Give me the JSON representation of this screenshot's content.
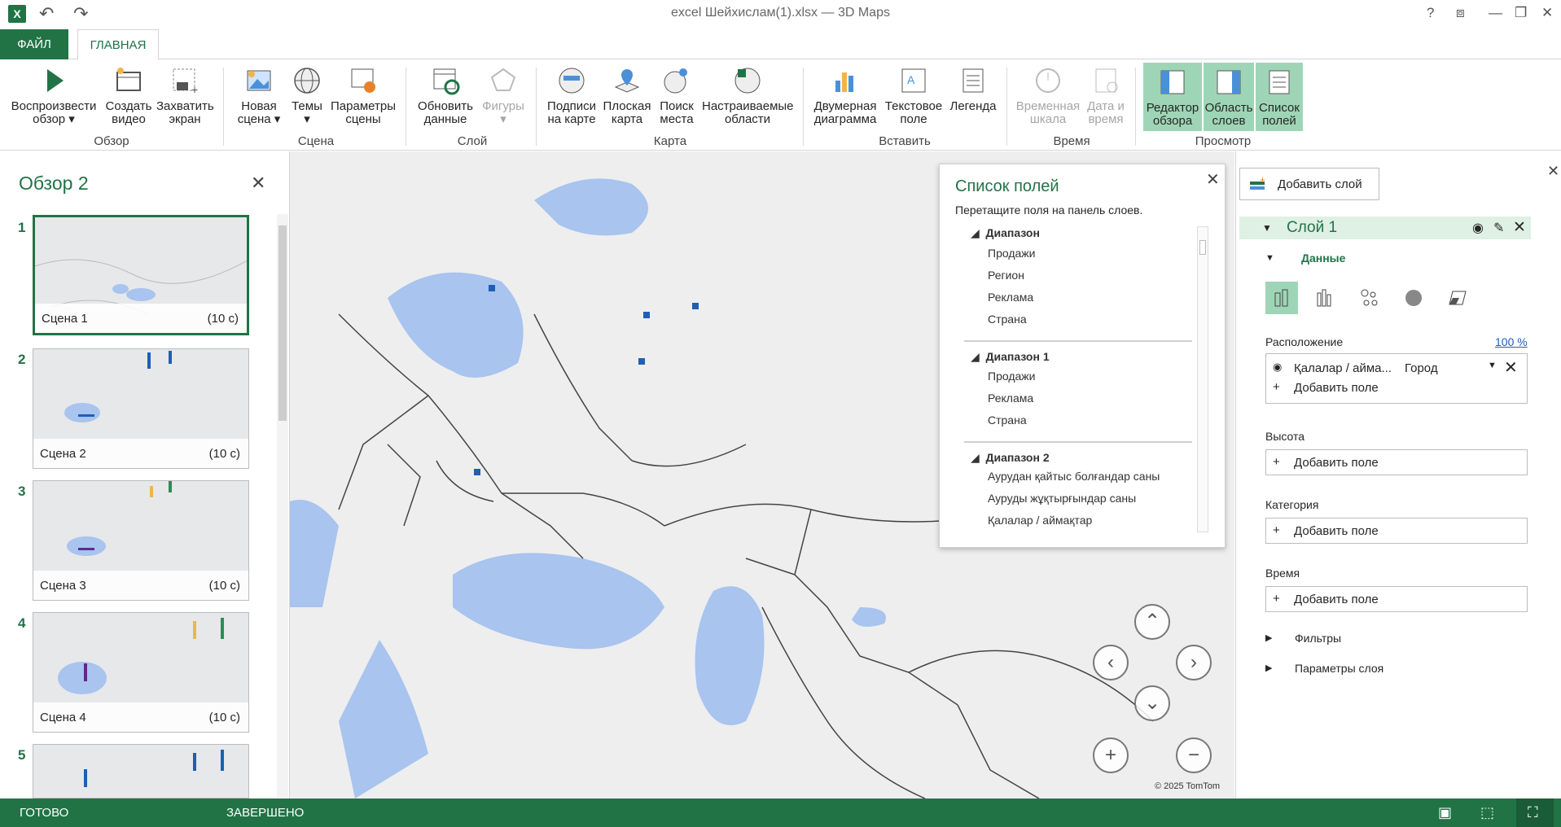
{
  "window": {
    "title": "excel Шейхислам(1).xlsx — 3D Maps"
  },
  "tabs": {
    "file": "ФАЙЛ",
    "home": "ГЛАВНАЯ"
  },
  "ribbon": {
    "groups": {
      "tour": "Обзор",
      "scene": "Сцена",
      "layer": "Слой",
      "map": "Карта",
      "insert": "Вставить",
      "time": "Время",
      "view": "Просмотр"
    },
    "buttons": {
      "play": "Воспроизвести обзор",
      "create_video": "Создать видео",
      "capture": "Захватить экран",
      "new_scene": "Новая сцена",
      "themes": "Темы",
      "scene_options": "Параметры сцены",
      "refresh": "Обновить данные",
      "shapes": "Фигуры",
      "map_labels": "Подписи на карте",
      "flat_map": "Плоская карта",
      "find_place": "Поиск места",
      "custom_regions": "Настраиваемые области",
      "chart2d": "Двумерная диаграмма",
      "textbox": "Текстовое поле",
      "legend": "Легенда",
      "timeline": "Временная шкала",
      "datetime": "Дата и время",
      "tour_editor": "Редактор обзора",
      "layer_pane": "Область слоев",
      "field_list": "Список полей"
    }
  },
  "tour_panel": {
    "title": "Обзор 2",
    "scenes": [
      {
        "num": "1",
        "name": "Сцена 1",
        "duration": "(10 с)"
      },
      {
        "num": "2",
        "name": "Сцена 2",
        "duration": "(10 с)"
      },
      {
        "num": "3",
        "name": "Сцена 3",
        "duration": "(10 с)"
      },
      {
        "num": "4",
        "name": "Сцена 4",
        "duration": "(10 с)"
      },
      {
        "num": "5",
        "name": "",
        "duration": ""
      }
    ]
  },
  "field_list": {
    "title": "Список полей",
    "hint": "Перетащите поля на панель слоев.",
    "groups": [
      {
        "name": "Диапазон",
        "fields": [
          "Продажи",
          "Регион",
          "Реклама",
          "Страна"
        ]
      },
      {
        "name": "Диапазон 1",
        "fields": [
          "Продажи",
          "Реклама",
          "Страна"
        ]
      },
      {
        "name": "Диапазон 2",
        "fields": [
          "Аурудан қайтыс болғандар саны",
          "Ауруды жұқтырғындар саны",
          "Қалалар / аймақтар"
        ]
      }
    ]
  },
  "layer_pane": {
    "add_layer": "Добавить слой",
    "layer_name": "Слой 1",
    "data_section": "Данные",
    "location_label": "Расположение",
    "location_percent": "100 %",
    "location_field": "Қалалар / айма...",
    "location_type": "Город",
    "add_field": "Добавить поле",
    "height_label": "Высота",
    "category_label": "Категория",
    "time_label": "Время",
    "filters": "Фильтры",
    "layer_options": "Параметры слоя"
  },
  "map": {
    "copyright": "© 2025 TomTom"
  },
  "status": {
    "ready": "ГОТОВО",
    "done": "ЗАВЕРШЕНО"
  },
  "colors": {
    "accent": "#217346",
    "selected": "#9fd5b7",
    "water": "#a8c4ef",
    "data": "#1e5fb4"
  }
}
